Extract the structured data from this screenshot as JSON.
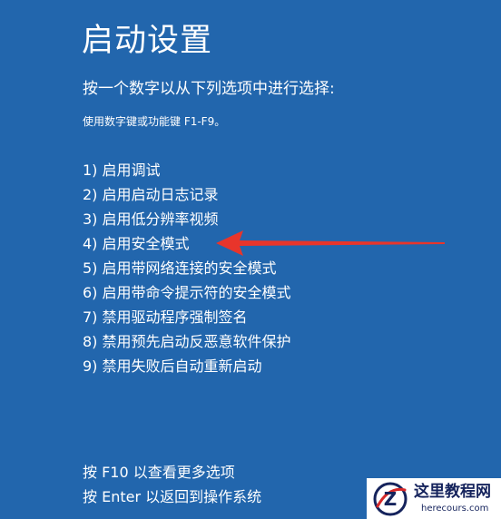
{
  "screen": {
    "title": "启动设置",
    "subtitle": "按一个数字以从下列选项中进行选择:",
    "hint": "使用数字键或功能键 F1-F9。",
    "options": [
      "1) 启用调试",
      "2) 启用启动日志记录",
      "3) 启用低分辨率视频",
      "4) 启用安全模式",
      "5) 启用带网络连接的安全模式",
      "6) 启用带命令提示符的安全模式",
      "7) 禁用驱动程序强制签名",
      "8) 禁用预先启动反恶意软件保护",
      "9) 禁用失败后自动重新启动"
    ],
    "footer": [
      "按 F10 以查看更多选项",
      "按 Enter 以返回到操作系统"
    ]
  },
  "annotation": {
    "arrow_color": "#e8352b",
    "points_to_option": 4
  },
  "watermark": {
    "name": "这里教程网",
    "url": "herecours.com",
    "logo_icon": "z-logo-icon",
    "logo_letter": "Z",
    "logo_accent_color": "#d62828"
  },
  "colors": {
    "background": "#2266ad",
    "text": "#ffffff"
  }
}
